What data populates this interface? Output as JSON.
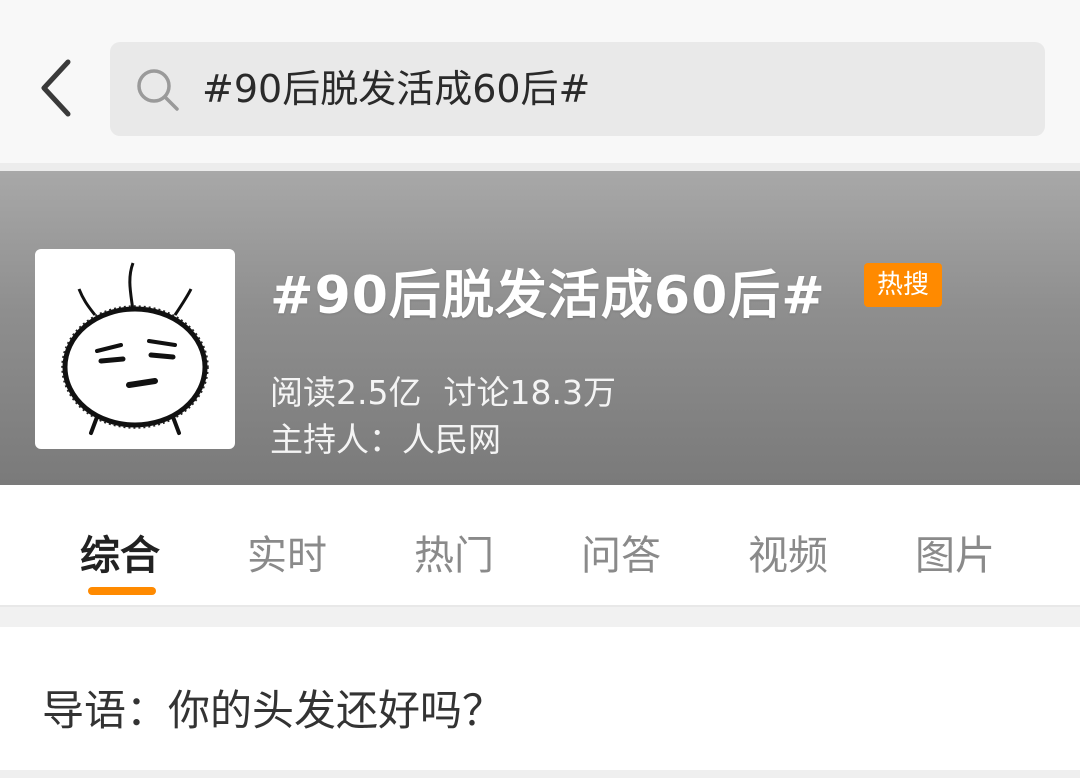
{
  "search": {
    "query": "#90后脱发活成60后#"
  },
  "topic": {
    "title": "#90后脱发活成60后#",
    "badge": "热搜",
    "reads": "阅读2.5亿",
    "discussions": "讨论18.3万",
    "host": "主持人：人民网"
  },
  "tabs": [
    {
      "label": "综合",
      "active": true
    },
    {
      "label": "实时",
      "active": false
    },
    {
      "label": "热门",
      "active": false
    },
    {
      "label": "问答",
      "active": false
    },
    {
      "label": "视频",
      "active": false
    },
    {
      "label": "图片",
      "active": false
    }
  ],
  "intro": {
    "text": "导语：你的头发还好吗？"
  },
  "colors": {
    "accent": "#ff8a00",
    "banner": "#8e8e8e"
  },
  "icons": {
    "back": "chevron-left-icon",
    "search": "search-icon",
    "avatar": "cartoon-face-avatar"
  }
}
